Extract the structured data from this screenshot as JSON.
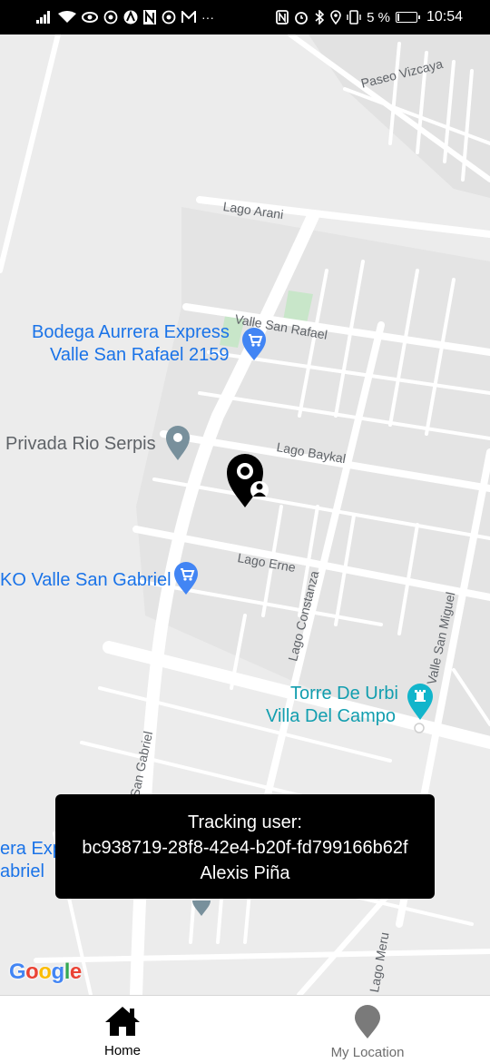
{
  "status_bar": {
    "time": "10:54",
    "battery_text": "5 %",
    "left_icons": [
      "signal-icon",
      "wifi-icon",
      "eye-icon",
      "whatsapp-icon",
      "arrival-icon",
      "n-icon",
      "whatsapp-icon",
      "gmail-icon",
      "more-icon"
    ],
    "right_icons": [
      "nfc-icon",
      "alarm-icon",
      "bluetooth-icon",
      "location-icon",
      "vibrate-icon",
      "battery-icon"
    ],
    "more_glyph": "···"
  },
  "map": {
    "streets": {
      "paseo_vizcaya": "Paseo Vizcaya",
      "lago_arani": "Lago Arani",
      "valle_san_rafael": "Valle San Rafael",
      "lago_baykal": "Lago Baykal",
      "lago_erne": "Lago Erne",
      "lago_constanza": "Lago Constanza",
      "valle_san_miguel": "Valle San Miguel",
      "san_gabriel": "San Gabriel",
      "lago_meru": "Lago Meru"
    },
    "pois": {
      "bodega_line1": "Bodega Aurrera Express",
      "bodega_line2": "Valle San Rafael 2159",
      "privada": "Privada Rio Serpis",
      "soriana": "KO Valle San Gabriel",
      "torre_line1": "Torre De Urbi",
      "torre_line2": "Villa Del Campo",
      "partial_line1": "era Exp",
      "partial_line2": "abriel"
    },
    "colors": {
      "poi_blue": "#1a73e8",
      "poi_teal": "#129eaf",
      "street_text": "#5f6368"
    }
  },
  "toast": {
    "line1": "Tracking user:",
    "line2": "bc938719-28f8-42e4-b20f-fd799166b62f",
    "line3": "Alexis Piña"
  },
  "attribution": "Google",
  "bottom_nav": {
    "items": [
      {
        "label": "Home",
        "icon": "home-icon",
        "active": true
      },
      {
        "label": "My Location",
        "icon": "location-pin-icon",
        "active": false
      }
    ]
  }
}
